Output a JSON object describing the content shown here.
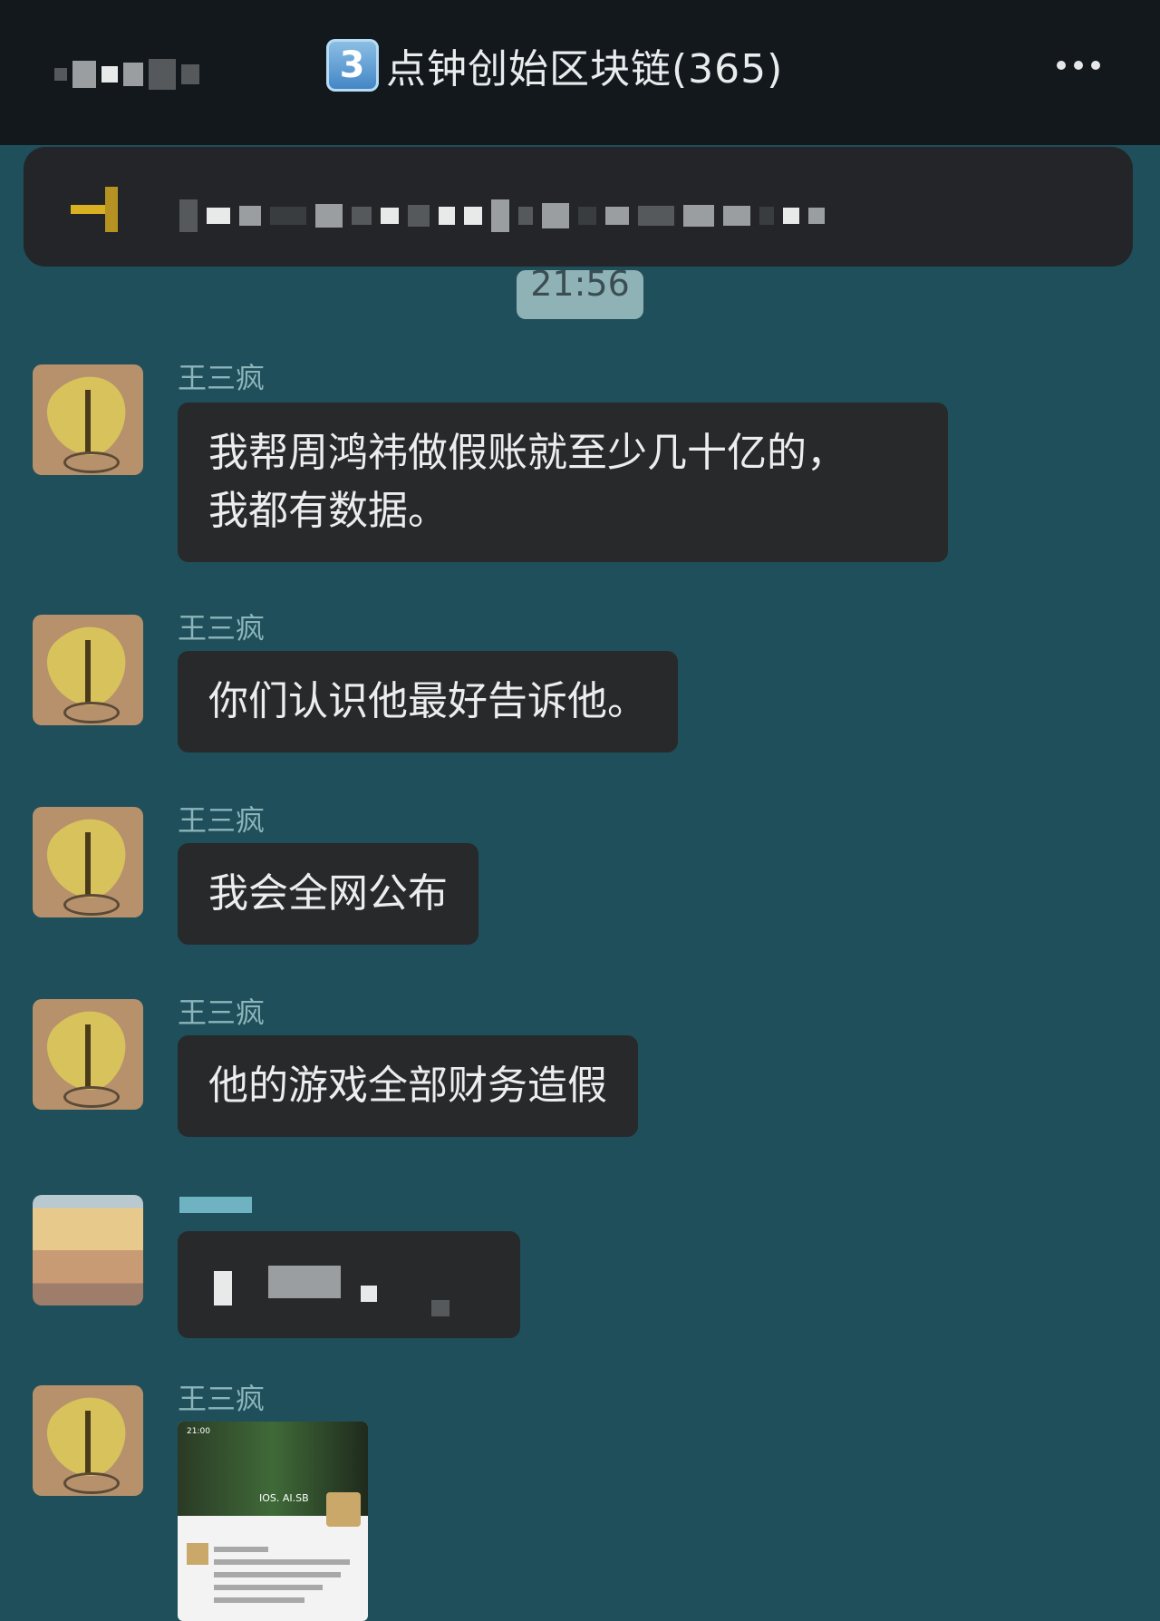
{
  "header": {
    "badge": "3",
    "title": "点钟创始区块链(365)",
    "more_icon": "more-dots-icon"
  },
  "timestamp": "21:56",
  "messages": [
    {
      "sender": "王三疯",
      "text": "我帮周鸿祎做假账就至少几十亿的，\n我都有数据。"
    },
    {
      "sender": "王三疯",
      "text": "你们认识他最好告诉他。"
    },
    {
      "sender": "王三疯",
      "text": "我会全网公布"
    },
    {
      "sender": "王三疯",
      "text": "他的游戏全部财务造假"
    },
    {
      "sender": "王三疯",
      "text": ""
    }
  ],
  "thumbnail": {
    "time": "21:00",
    "profile_name": "IOS. AI.SB"
  },
  "colors": {
    "background": "#1e4f5a",
    "bubble": "#28292a",
    "name": "#8cb4ba"
  }
}
